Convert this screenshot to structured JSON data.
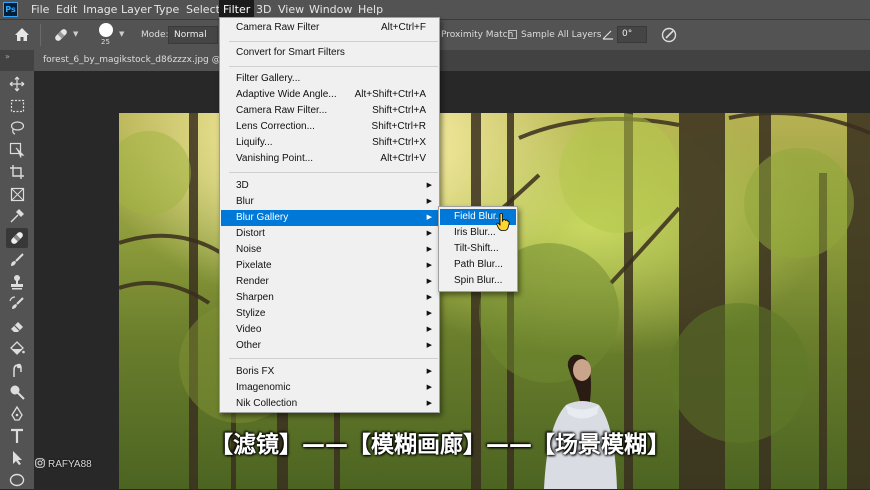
{
  "app": {
    "logo": "Ps"
  },
  "menubar": {
    "items": [
      "File",
      "Edit",
      "Image",
      "Layer",
      "Type",
      "Select",
      "Filter",
      "3D",
      "View",
      "Window",
      "Help"
    ],
    "active": "Filter"
  },
  "options": {
    "brush_size": "25",
    "mode_label": "Mode:",
    "mode_value": "Normal",
    "proximity_label": "Proximity Match",
    "sample_all_label": "Sample All Layers",
    "angle_value": "0°"
  },
  "document": {
    "tab_title": "forest_6_by_magikstock_d86zzzx.jpg @"
  },
  "filter_menu": {
    "camera_raw_last": {
      "label": "Camera Raw Filter",
      "shortcut": "Alt+Ctrl+F"
    },
    "convert_smart": {
      "label": "Convert for Smart Filters"
    },
    "filter_gallery": {
      "label": "Filter Gallery..."
    },
    "adaptive_wide": {
      "label": "Adaptive Wide Angle...",
      "shortcut": "Alt+Shift+Ctrl+A"
    },
    "camera_raw": {
      "label": "Camera Raw Filter...",
      "shortcut": "Shift+Ctrl+A"
    },
    "lens_correction": {
      "label": "Lens Correction...",
      "shortcut": "Shift+Ctrl+R"
    },
    "liquify": {
      "label": "Liquify...",
      "shortcut": "Shift+Ctrl+X"
    },
    "vanishing_point": {
      "label": "Vanishing Point...",
      "shortcut": "Alt+Ctrl+V"
    },
    "group1": [
      "3D",
      "Blur",
      "Blur Gallery",
      "Distort",
      "Noise",
      "Pixelate",
      "Render",
      "Sharpen",
      "Stylize",
      "Video",
      "Other"
    ],
    "group2": [
      "Boris FX",
      "Imagenomic",
      "Nik Collection"
    ],
    "highlighted": "Blur Gallery"
  },
  "blur_gallery_submenu": {
    "items": [
      "Field Blur...",
      "Iris Blur...",
      "Tilt-Shift...",
      "Path Blur...",
      "Spin Blur..."
    ],
    "highlighted": "Field Blur..."
  },
  "subtitle": "【滤镜】——【模糊画廊】——【场景模糊】",
  "watermark": "RAFYA88",
  "colors": {
    "highlight": "#0078d7",
    "menu_bg": "#f0f0f0",
    "ui_dark": "#535353",
    "app_bg": "#282828"
  }
}
